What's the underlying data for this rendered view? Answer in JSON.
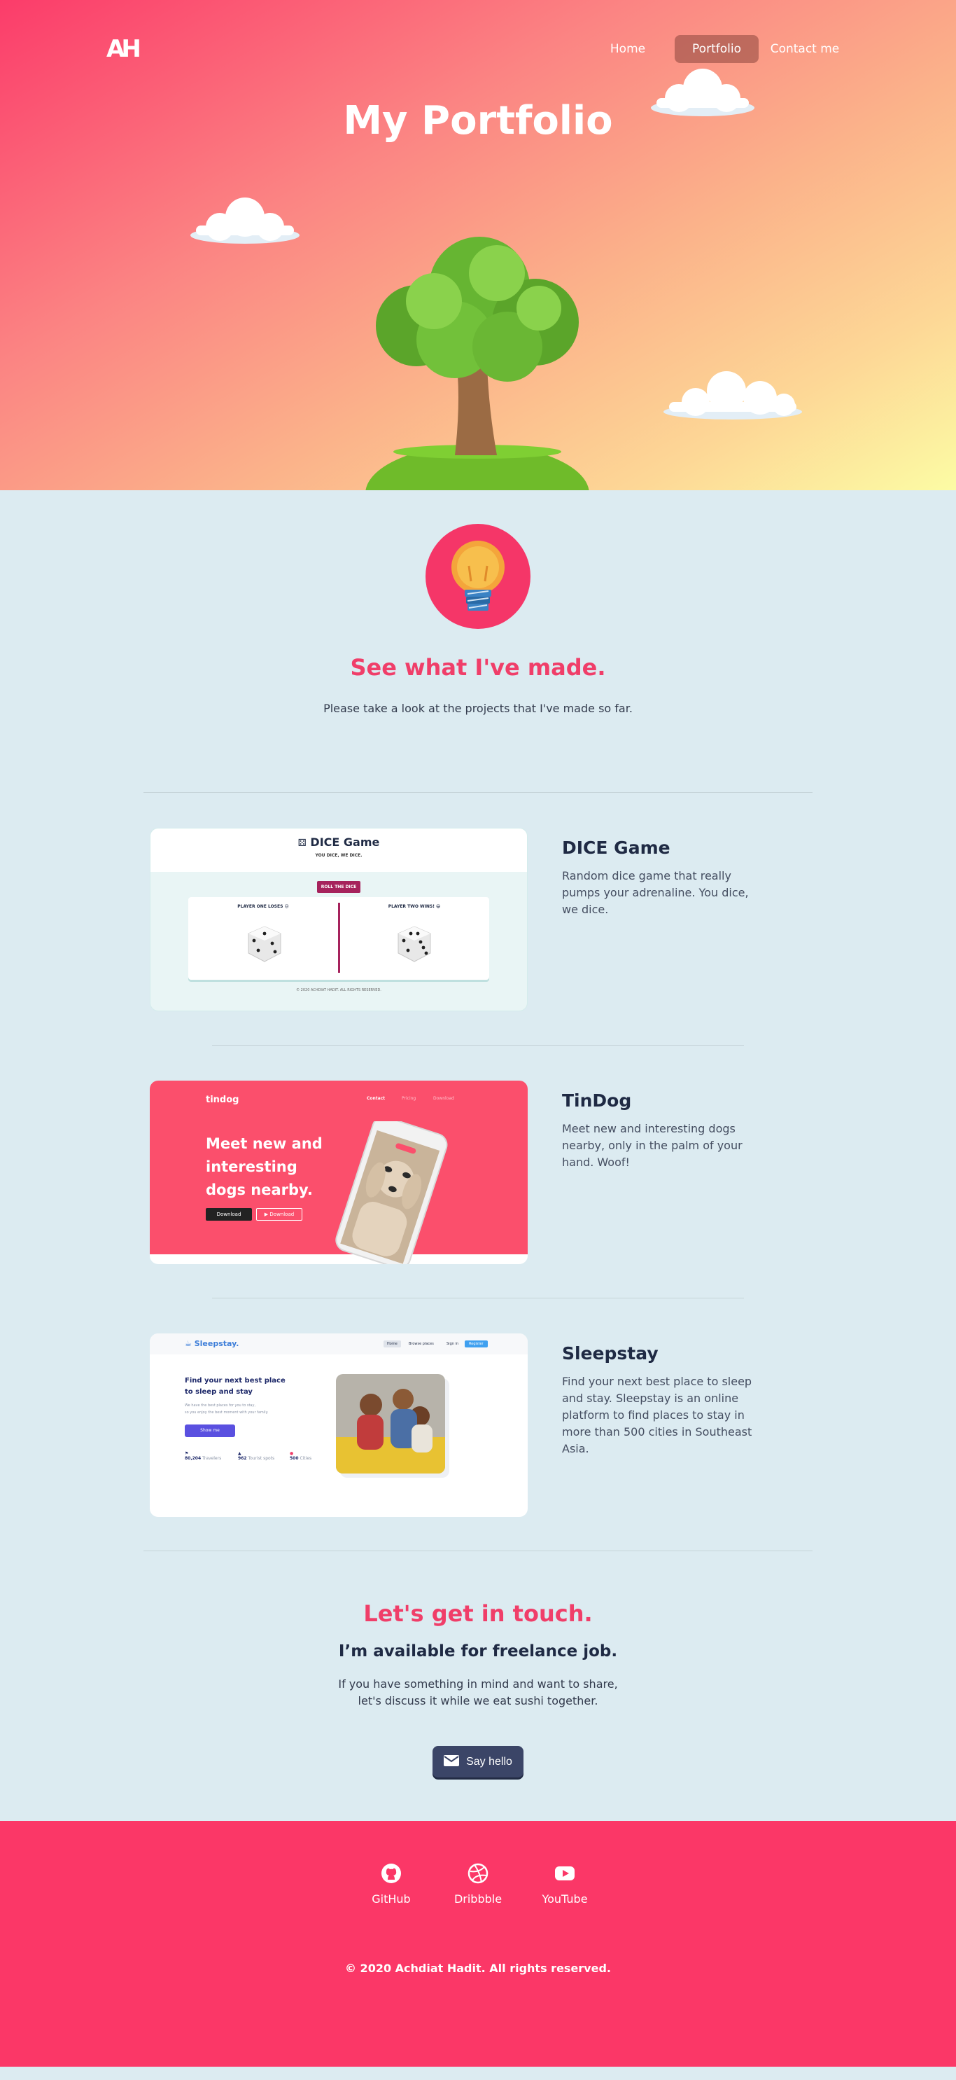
{
  "header": {
    "logo": "AH",
    "nav": [
      "Home",
      "Portfolio",
      "Contact me"
    ],
    "title": "My Portfolio"
  },
  "intro": {
    "heading": "See what I've made.",
    "text": "Please take a look at the projects that I've made so far."
  },
  "projects": [
    {
      "title": "DICE Game",
      "description": "Random dice game that really pumps your adrenaline. You dice, we dice.",
      "thumb": {
        "heading": "DICE Game",
        "tagline": "YOU DICE, WE DICE.",
        "button": "ROLL THE DICE",
        "player1": "PLAYER ONE LOSES 😖",
        "player2": "PLAYER TWO WINS! 😁",
        "footer": "© 2020 ACHDIAT HADIT. ALL RIGHTS RESERVED."
      }
    },
    {
      "title": "TinDog",
      "description": "Meet new and interesting dogs nearby, only in the palm of your hand. Woof!",
      "thumb": {
        "brand": "tindog",
        "nav": [
          "Contact",
          "Pricing",
          "Download"
        ],
        "headline1": "Meet new and",
        "headline2": "interesting",
        "headline3": "dogs nearby.",
        "btn1": "Download",
        "btn2": "Download"
      }
    },
    {
      "title": "Sleepstay",
      "description": "Find your next best place to sleep and stay. Sleepstay is an online platform to find places to stay in more than 500 cities in Southeast Asia.",
      "thumb": {
        "brand": "Sleepstay.",
        "nav": [
          "Home",
          "Browse places",
          "Sign in",
          "Register"
        ],
        "headline1": "Find your next best place",
        "headline2": "to sleep and stay",
        "sub1": "We have the best places for you to stay,",
        "sub2": "so you enjoy the best moment with your family.",
        "button": "Show me",
        "stat1": "80,204",
        "stat1_label": "Travelers",
        "stat2": "962",
        "stat2_label": "Tourist spots",
        "stat3": "500",
        "stat3_label": "Cities"
      }
    }
  ],
  "contact": {
    "heading": "Let's get in touch.",
    "subheading": "I’m available for freelance job.",
    "line1": "If you have something in mind and want to share,",
    "line2": "let's discuss it while we eat sushi together.",
    "button": "Say hello"
  },
  "footer": {
    "links": [
      {
        "label": "GitHub",
        "icon": "github-icon"
      },
      {
        "label": "Dribbble",
        "icon": "dribbble-icon"
      },
      {
        "label": "YouTube",
        "icon": "youtube-icon"
      }
    ],
    "copyright": "© 2020 Achdiat Hadit. All rights reserved."
  },
  "colors": {
    "accent": "#f03e69",
    "footer": "#fb3767",
    "section_bg": "#dcebf1",
    "dark": "#1f2a44"
  }
}
